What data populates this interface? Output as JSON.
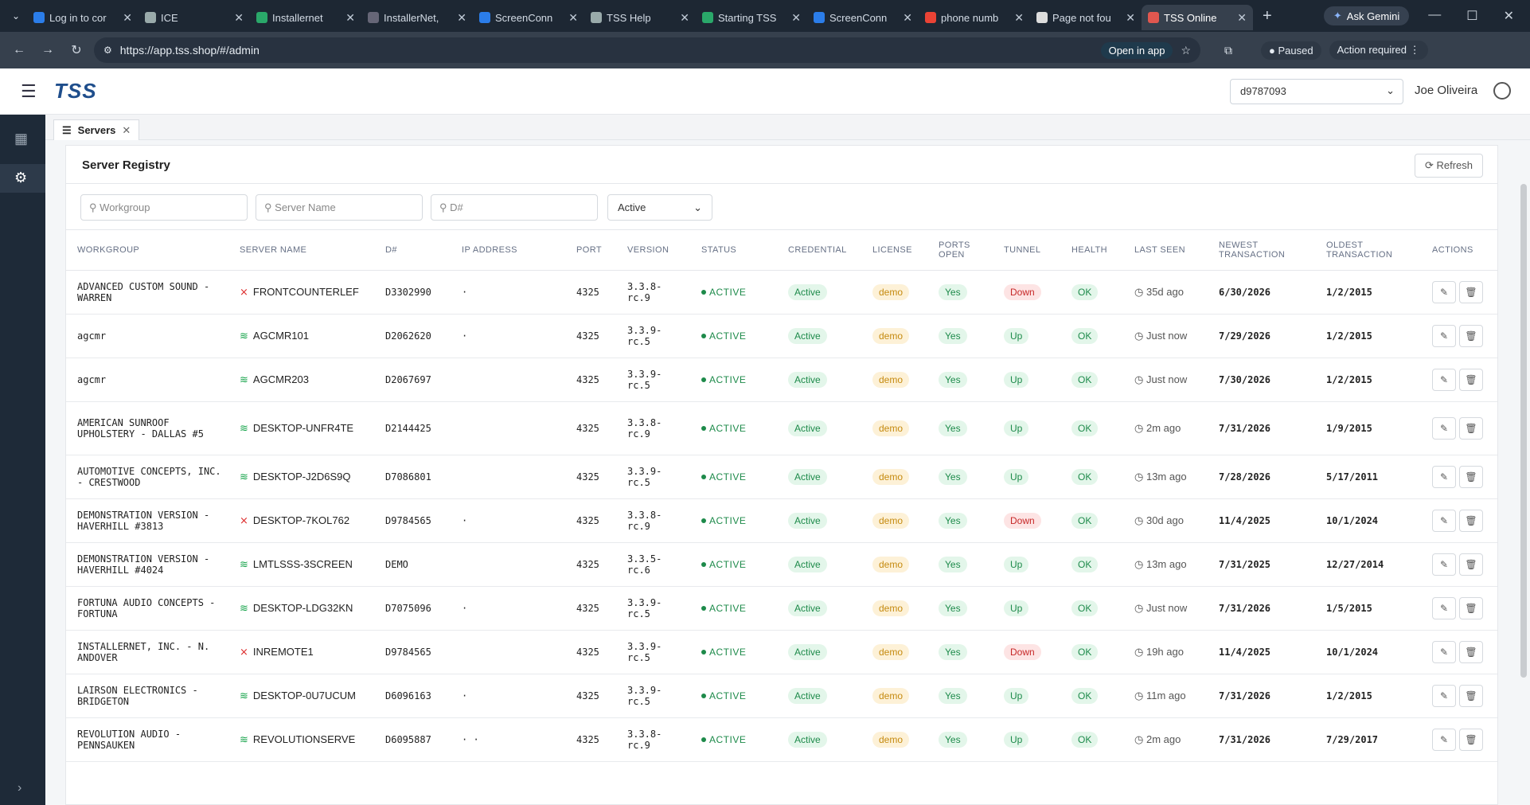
{
  "browser": {
    "tabs": [
      {
        "title": "Log in to cor",
        "color": "#2b7de9"
      },
      {
        "title": "ICE",
        "color": "#9aa"
      },
      {
        "title": "Installernet",
        "color": "#2aa86a"
      },
      {
        "title": "InstallerNet,",
        "color": "#667"
      },
      {
        "title": "ScreenConn",
        "color": "#2b7de9"
      },
      {
        "title": "TSS Help",
        "color": "#9aa"
      },
      {
        "title": "Starting TSS",
        "color": "#2aa86a"
      },
      {
        "title": "ScreenConn",
        "color": "#2b7de9"
      },
      {
        "title": "phone numb",
        "color": "#ea4335"
      },
      {
        "title": "Page not fou",
        "color": "#ddd"
      },
      {
        "title": "TSS Online",
        "color": "#e0574f"
      }
    ],
    "gemini": "Ask Gemini",
    "url": "https://app.tss.shop/#/admin",
    "open_in_app": "Open in app",
    "paused": "Paused",
    "action_required": "Action required"
  },
  "app": {
    "logo": "TSS",
    "workgroup_select": "d9787093",
    "user_name": "Joe Oliveira",
    "tab_label": "Servers",
    "title": "Server Registry",
    "refresh": "Refresh"
  },
  "filters": {
    "workgroup": "Workgroup",
    "server": "Server Name",
    "dnum": "D#",
    "status": "Active"
  },
  "columns": [
    "Workgroup",
    "Server Name",
    "D#",
    "IP Address",
    "Port",
    "Version",
    "Status",
    "Credential",
    "License",
    "Ports Open",
    "Tunnel",
    "Health",
    "Last Seen",
    "Newest Transaction",
    "Oldest Transaction",
    "Actions"
  ],
  "rows": [
    {
      "workgroup": "ADVANCED CUSTOM SOUND - WARREN",
      "server": "FRONTCOUNTERLEF",
      "online": false,
      "dnum": "D3302990",
      "ip": "·",
      "port": "4325",
      "version": "3.3.8-rc.9",
      "status": "ACTIVE",
      "credential": "Active",
      "license": "demo",
      "ports": "Yes",
      "tunnel": "Down",
      "health": "OK",
      "last_seen": "35d ago",
      "newest": "6/30/2026",
      "oldest": "1/2/2015"
    },
    {
      "workgroup": "agcmr",
      "server": "AGCMR101",
      "online": true,
      "dnum": "D2062620",
      "ip": "·",
      "port": "4325",
      "version": "3.3.9-rc.5",
      "status": "ACTIVE",
      "credential": "Active",
      "license": "demo",
      "ports": "Yes",
      "tunnel": "Up",
      "health": "OK",
      "last_seen": "Just now",
      "newest": "7/29/2026",
      "oldest": "1/2/2015"
    },
    {
      "workgroup": "agcmr",
      "server": "AGCMR203",
      "online": true,
      "dnum": "D2067697",
      "ip": "",
      "port": "4325",
      "version": "3.3.9-rc.5",
      "status": "ACTIVE",
      "credential": "Active",
      "license": "demo",
      "ports": "Yes",
      "tunnel": "Up",
      "health": "OK",
      "last_seen": "Just now",
      "newest": "7/30/2026",
      "oldest": "1/2/2015"
    },
    {
      "workgroup": "AMERICAN SUNROOF UPHOLSTERY - DALLAS #5",
      "server": "DESKTOP-UNFR4TE",
      "online": true,
      "dnum": "D2144425",
      "ip": "",
      "port": "4325",
      "version": "3.3.8-rc.9",
      "status": "ACTIVE",
      "credential": "Active",
      "license": "demo",
      "ports": "Yes",
      "tunnel": "Up",
      "health": "OK",
      "last_seen": "2m ago",
      "newest": "7/31/2026",
      "oldest": "1/9/2015"
    },
    {
      "workgroup": "AUTOMOTIVE CONCEPTS, INC. - CRESTWOOD",
      "server": "DESKTOP-J2D6S9Q",
      "online": true,
      "dnum": "D7086801",
      "ip": "",
      "port": "4325",
      "version": "3.3.9-rc.5",
      "status": "ACTIVE",
      "credential": "Active",
      "license": "demo",
      "ports": "Yes",
      "tunnel": "Up",
      "health": "OK",
      "last_seen": "13m ago",
      "newest": "7/28/2026",
      "oldest": "5/17/2011"
    },
    {
      "workgroup": "DEMONSTRATION VERSION - HAVERHILL #3813",
      "server": "DESKTOP-7KOL762",
      "online": false,
      "dnum": "D9784565",
      "ip": "·",
      "port": "4325",
      "version": "3.3.8-rc.9",
      "status": "ACTIVE",
      "credential": "Active",
      "license": "demo",
      "ports": "Yes",
      "tunnel": "Down",
      "health": "OK",
      "last_seen": "30d ago",
      "newest": "11/4/2025",
      "oldest": "10/1/2024"
    },
    {
      "workgroup": "DEMONSTRATION VERSION - HAVERHILL #4024",
      "server": "LMTLSSS-3SCREEN",
      "online": true,
      "dnum": "DEMO",
      "ip": "",
      "port": "4325",
      "version": "3.3.5-rc.6",
      "status": "ACTIVE",
      "credential": "Active",
      "license": "demo",
      "ports": "Yes",
      "tunnel": "Up",
      "health": "OK",
      "last_seen": "13m ago",
      "newest": "7/31/2025",
      "oldest": "12/27/2014"
    },
    {
      "workgroup": "FORTUNA AUDIO CONCEPTS - FORTUNA",
      "server": "DESKTOP-LDG32KN",
      "online": true,
      "dnum": "D7075096",
      "ip": "·",
      "port": "4325",
      "version": "3.3.9-rc.5",
      "status": "ACTIVE",
      "credential": "Active",
      "license": "demo",
      "ports": "Yes",
      "tunnel": "Up",
      "health": "OK",
      "last_seen": "Just now",
      "newest": "7/31/2026",
      "oldest": "1/5/2015"
    },
    {
      "workgroup": "INSTALLERNET, INC. - N. ANDOVER",
      "server": "INREMOTE1",
      "online": false,
      "dnum": "D9784565",
      "ip": "",
      "port": "4325",
      "version": "3.3.9-rc.5",
      "status": "ACTIVE",
      "credential": "Active",
      "license": "demo",
      "ports": "Yes",
      "tunnel": "Down",
      "health": "OK",
      "last_seen": "19h ago",
      "newest": "11/4/2025",
      "oldest": "10/1/2024"
    },
    {
      "workgroup": "LAIRSON ELECTRONICS - BRIDGETON",
      "server": "DESKTOP-0U7UCUM",
      "online": true,
      "dnum": "D6096163",
      "ip": "·",
      "port": "4325",
      "version": "3.3.9-rc.5",
      "status": "ACTIVE",
      "credential": "Active",
      "license": "demo",
      "ports": "Yes",
      "tunnel": "Up",
      "health": "OK",
      "last_seen": "11m ago",
      "newest": "7/31/2026",
      "oldest": "1/2/2015"
    },
    {
      "workgroup": "REVOLUTION AUDIO - PENNSAUKEN",
      "server": "REVOLUTIONSERVE",
      "online": true,
      "dnum": "D6095887",
      "ip": "·  ·",
      "port": "4325",
      "version": "3.3.8-rc.9",
      "status": "ACTIVE",
      "credential": "Active",
      "license": "demo",
      "ports": "Yes",
      "tunnel": "Up",
      "health": "OK",
      "last_seen": "2m ago",
      "newest": "7/31/2026",
      "oldest": "7/29/2017"
    }
  ]
}
